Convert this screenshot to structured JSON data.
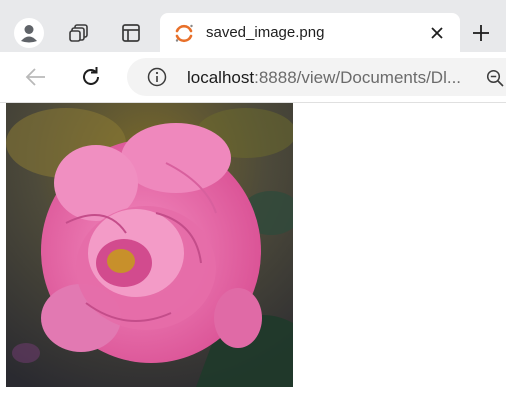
{
  "tab": {
    "title": "saved_image.png"
  },
  "tabstrip": {
    "profile_icon": "profile-avatar-icon",
    "collections_icon": "tab-actions-icon",
    "sidebar_icon": "vertical-tabs-icon",
    "close_icon": "close-icon",
    "new_tab_icon": "plus-icon",
    "new_tab_label": "+"
  },
  "navigation": {
    "back_icon": "arrow-left-icon",
    "refresh_icon": "refresh-icon",
    "site_info_icon": "info-icon",
    "zoom_icon": "zoom-icon"
  },
  "address_bar": {
    "host": "localhost",
    "path": ":8888/view/Documents/Dl..."
  },
  "colors": {
    "tabstrip_bg": "#e8e9eb",
    "active_tab_bg": "#ffffff",
    "omnibox_bg": "#f3f3f3",
    "favicon_accent": "#e8702a"
  },
  "content": {
    "image_description_icon": "rose-photo"
  }
}
